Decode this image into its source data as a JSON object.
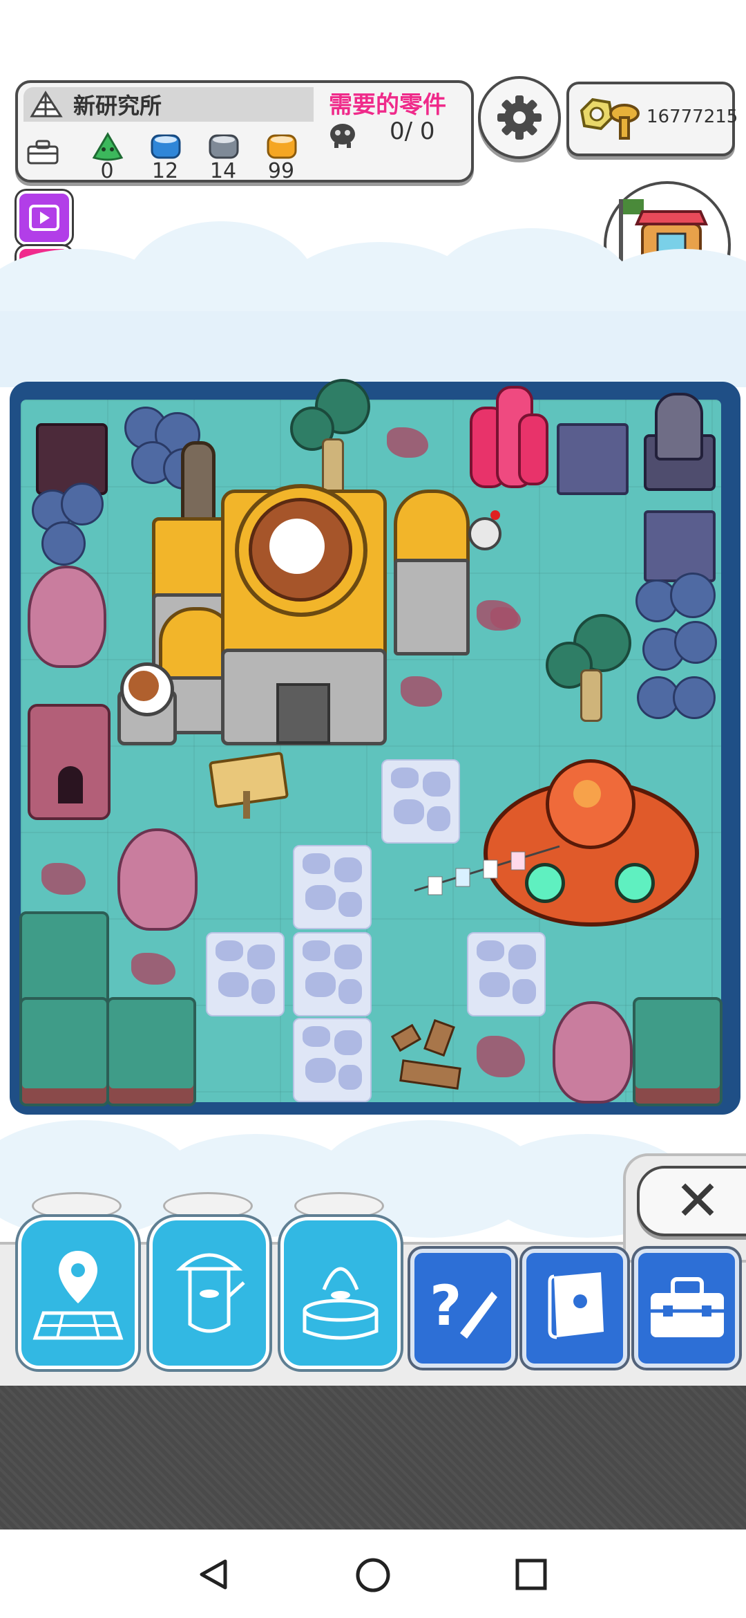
{
  "hud": {
    "lab_name": "新研究所",
    "parts_label": "需要的零件",
    "parts_value": "0/ 0",
    "resources": [
      {
        "icon": "green-slime-icon",
        "value": "0",
        "color": "#3cb85c"
      },
      {
        "icon": "blue-can-icon",
        "value": "12",
        "color": "#2f86d8"
      },
      {
        "icon": "grey-can-icon",
        "value": "14",
        "color": "#7f8a97"
      },
      {
        "icon": "orange-can-icon",
        "value": "99",
        "color": "#f5a623"
      }
    ]
  },
  "currency": {
    "icon": "nut-and-screw-icon",
    "value": "16777215"
  },
  "side_buttons": [
    {
      "icon": "video-icon",
      "color": "#b23ee8"
    },
    {
      "icon": "exclamation-icon",
      "color": "#f02b8d"
    },
    {
      "icon": "check-icon",
      "color": "#25d07a"
    }
  ],
  "bottom_bar": {
    "close_label": "✕",
    "capsules": [
      "map-pin-grid-icon",
      "mushroom-character-icon",
      "character-in-can-icon"
    ],
    "squares": [
      "help-icon",
      "book-icon",
      "toolbox-icon"
    ]
  },
  "colors": {
    "accent_pink": "#ef2a8a",
    "map_water": "#5fc3bd",
    "map_border": "#1f4f86"
  }
}
